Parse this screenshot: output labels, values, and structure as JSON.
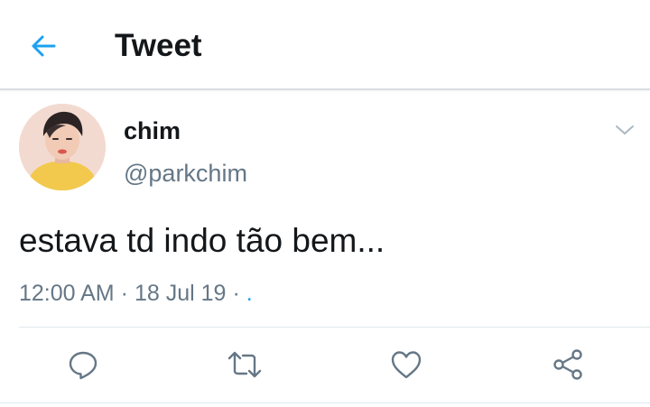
{
  "header": {
    "title": "Tweet",
    "back_icon": "arrow-left-icon"
  },
  "tweet": {
    "display_name": "chim",
    "handle": "@parkchim",
    "text": "estava td indo tão bem...",
    "time": "12:00 AM",
    "date": "18 Jul 19",
    "separator": "·",
    "source": ".",
    "caret_icon": "chevron-down-icon"
  },
  "actions": [
    {
      "name": "reply",
      "icon": "reply-icon"
    },
    {
      "name": "retweet",
      "icon": "retweet-icon"
    },
    {
      "name": "like",
      "icon": "heart-icon"
    },
    {
      "name": "share",
      "icon": "share-icon"
    }
  ],
  "colors": {
    "accent": "#1da1f2",
    "text_primary": "#14171a",
    "text_secondary": "#657786",
    "divider": "#e1e8ed"
  }
}
